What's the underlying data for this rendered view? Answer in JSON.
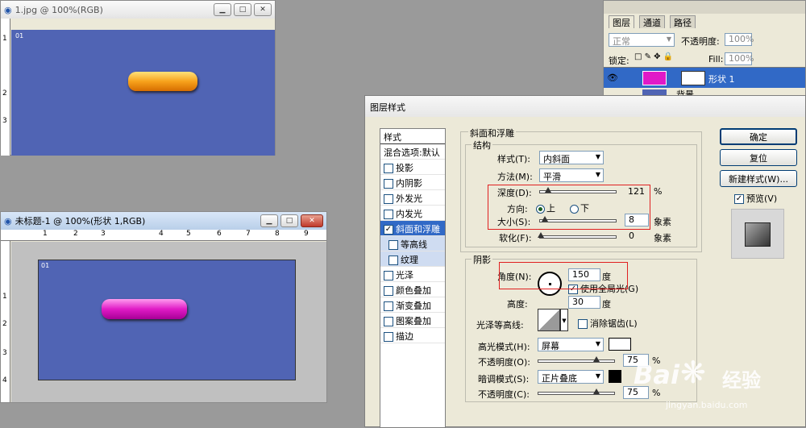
{
  "win1": {
    "title": "1.jpg @ 100%(RGB)",
    "badge": "01"
  },
  "win2": {
    "title": "未标题-1 @ 100%(形状 1,RGB)",
    "badge": "01"
  },
  "ruler_h1": [
    "1",
    "2",
    "3",
    "4",
    "5",
    "6",
    "7",
    "8",
    "9"
  ],
  "ruler_v1": [
    "1",
    "2",
    "3"
  ],
  "ruler_v2": [
    "1",
    "2",
    "3",
    "4"
  ],
  "layers": {
    "tabs": [
      "图层",
      "通道",
      "路径"
    ],
    "blend_mode": "正常",
    "opacity_label": "不透明度:",
    "opacity": "100%",
    "lock_label": "锁定:",
    "fill_label": "Fill:",
    "fill": "100%",
    "layer1": "形状 1",
    "layer2": "背景"
  },
  "dialog": {
    "title": "图层样式",
    "styles_header": "样式",
    "styles": [
      "混合选项:默认",
      "投影",
      "内阴影",
      "外发光",
      "内发光",
      "斜面和浮雕",
      "等高线",
      "纹理",
      "光泽",
      "颜色叠加",
      "渐变叠加",
      "图案叠加",
      "描边"
    ],
    "bevel_title": "斜面和浮雕",
    "structure_title": "结构",
    "style_label": "样式(T):",
    "style_value": "内斜面",
    "method_label": "方法(M):",
    "method_value": "平滑",
    "depth_label": "深度(D):",
    "depth_value": "121",
    "pct": "%",
    "direction_label": "方向:",
    "dir_up": "上",
    "dir_down": "下",
    "size_label": "大小(S):",
    "size_value": "8",
    "px": "象素",
    "soften_label": "软化(F):",
    "soften_value": "0",
    "shading_title": "阴影",
    "angle_label": "角度(N):",
    "angle_value": "150",
    "deg": "度",
    "global_light": "使用全局光(G)",
    "altitude_label": "高度:",
    "altitude_value": "30",
    "gloss_label": "光泽等高线:",
    "antialias": "消除锯齿(L)",
    "highlight_label": "高光模式(H):",
    "highlight_value": "屏幕",
    "opacity_label": "不透明度(O):",
    "hl_opacity": "75",
    "shadow_label": "暗调模式(S):",
    "shadow_value": "正片叠底",
    "opacity_label2": "不透明度(C):",
    "sh_opacity": "75",
    "ok": "确定",
    "reset": "复位",
    "new_style": "新建样式(W)...",
    "preview": "预览(V)"
  },
  "watermark": {
    "brand": "Bai",
    "brand2": "经验",
    "url": "jingyan.baidu.com"
  }
}
